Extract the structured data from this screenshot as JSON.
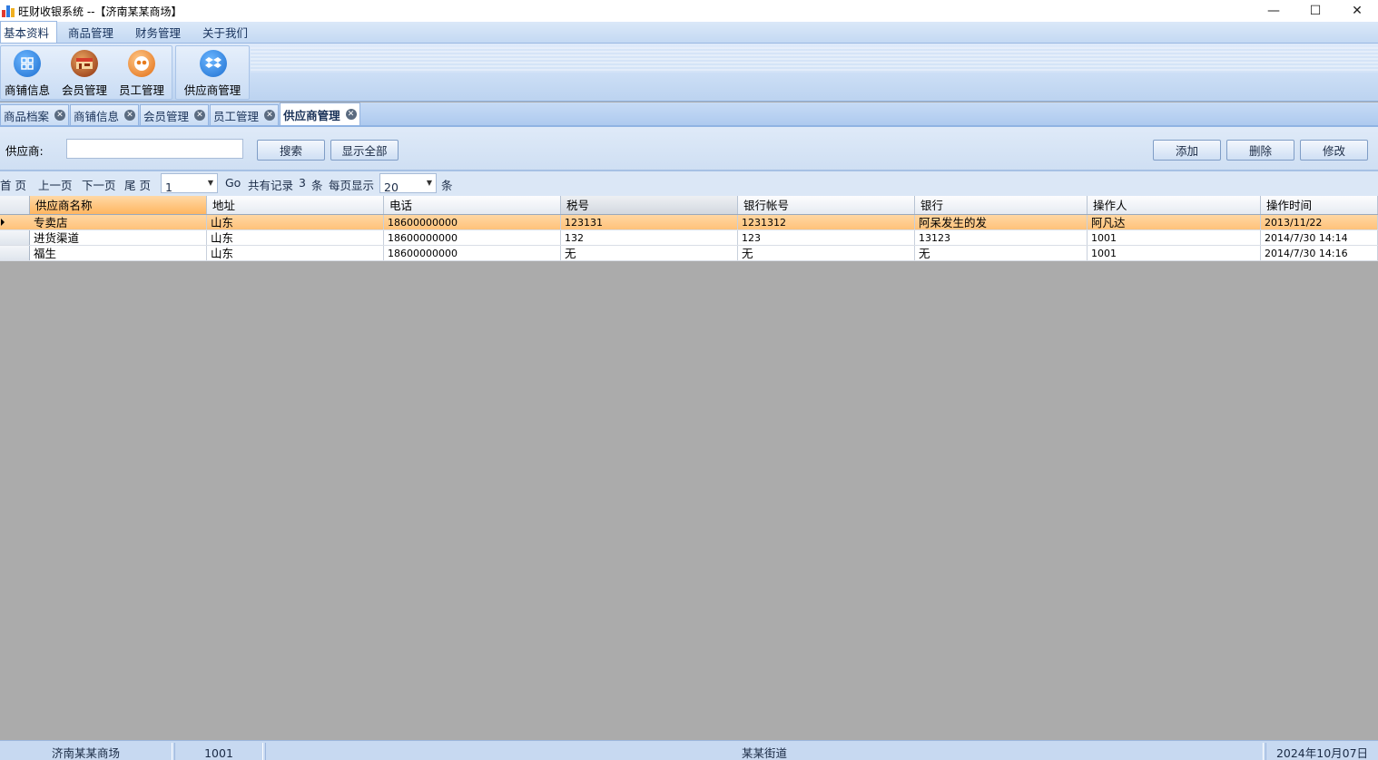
{
  "window": {
    "title": "旺财收银系统 --【济南某某商场】",
    "minimize": "—",
    "maximize": "☐",
    "close": "✕"
  },
  "ribbon": {
    "tabs": [
      "基本资料",
      "商品管理",
      "财务管理",
      "关于我们"
    ],
    "buttons": [
      {
        "label": "商铺信息",
        "icon": "grid-icon",
        "color": "#2e8ae6"
      },
      {
        "label": "会员管理",
        "icon": "store-icon",
        "color": "#c0531b"
      },
      {
        "label": "员工管理",
        "icon": "people-icon",
        "color": "#e67a1c"
      },
      {
        "label": "供应商管理",
        "icon": "dropbox-icon",
        "color": "#2e8ae6"
      }
    ]
  },
  "doc_tabs": [
    "商品档案",
    "商铺信息",
    "会员管理",
    "员工管理",
    "供应商管理"
  ],
  "search": {
    "label": "供应商:",
    "value": "",
    "search_btn": "搜索",
    "show_all_btn": "显示全部",
    "add_btn": "添加",
    "delete_btn": "删除",
    "edit_btn": "修改"
  },
  "pager": {
    "first": "首  页",
    "prev": "上一页",
    "next": "下一页",
    "last": "尾  页",
    "page": "1",
    "go": "Go",
    "total_label": "共有记录",
    "total": "3",
    "unit": "条",
    "per_page_label": "每页显示",
    "per_page": "20",
    "unit2": "条"
  },
  "table": {
    "columns": [
      "供应商名称",
      "地址",
      "电话",
      "税号",
      "银行帐号",
      "银行",
      "操作人",
      "操作时间"
    ],
    "rows": [
      [
        "专卖店",
        "山东",
        "18600000000",
        "123131",
        "1231312",
        "阿呆发生的发",
        "阿凡达",
        "2013/11/22"
      ],
      [
        "进货渠道",
        "山东",
        "18600000000",
        "132",
        "123",
        "13123",
        "1001",
        "2014/7/30 14:14"
      ],
      [
        "福生",
        "山东",
        "18600000000",
        "无",
        "无",
        "无",
        "1001",
        "2014/7/30 14:16"
      ]
    ]
  },
  "status": {
    "store": "济南某某商场",
    "user": "1001",
    "address": "某某街道",
    "date": "2024年10月07日"
  }
}
